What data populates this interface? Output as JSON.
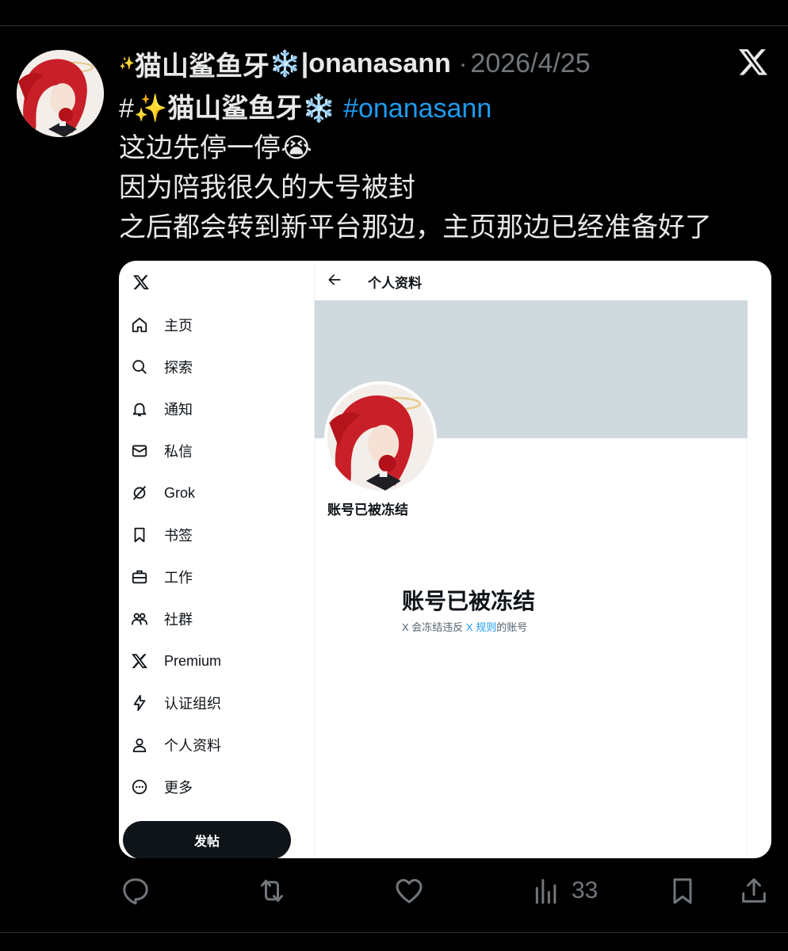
{
  "colors": {
    "background": "#000000",
    "text": "#e7e9ea",
    "muted": "#71767b",
    "link": "#1d9bf0",
    "banner": "#cfd9de",
    "post_button": "#0f1419"
  },
  "post": {
    "header": {
      "sparkle": "✨",
      "name": "猫山鲨鱼牙",
      "snowflake": "❄️",
      "handle": "|onanasann",
      "separator": "·",
      "date": "2026/4/25"
    },
    "line1": {
      "hash": "#",
      "sparkle": "✨",
      "name": "猫山鲨鱼牙",
      "snowflake": "❄️",
      "hashtag": "#onanasann"
    },
    "line2": "这边先停一停😭",
    "line3": "因为陪我很久的大号被封",
    "line4": "之后都会转到新平台那边，主页那边已经准备好了",
    "icons": [
      "x-logo-icon",
      "avatar",
      "sparkle-emoji",
      "snowflake-emoji",
      "crying-emoji"
    ]
  },
  "embedded": {
    "nav": [
      {
        "label": "主页",
        "icon": "home-icon"
      },
      {
        "label": "探索",
        "icon": "search-icon"
      },
      {
        "label": "通知",
        "icon": "bell-icon"
      },
      {
        "label": "私信",
        "icon": "mail-icon"
      },
      {
        "label": "Grok",
        "icon": "grok-icon"
      },
      {
        "label": "书签",
        "icon": "bookmark-icon"
      },
      {
        "label": "工作",
        "icon": "briefcase-icon"
      },
      {
        "label": "社群",
        "icon": "communities-icon"
      },
      {
        "label": "Premium",
        "icon": "x-icon"
      },
      {
        "label": "认证组织",
        "icon": "lightning-icon"
      },
      {
        "label": "个人资料",
        "icon": "profile-icon"
      },
      {
        "label": "更多",
        "icon": "more-icon"
      }
    ],
    "post_button": "发帖",
    "topbar_title": "个人资料",
    "frozen_label": "账号已被冻结",
    "frozen_title": "账号已被冻结",
    "frozen_desc_prefix": "X 会冻结违反",
    "frozen_desc_link": "X 规则",
    "frozen_desc_suffix": "的账号"
  },
  "actions": {
    "views_count": "33",
    "icons": [
      "reply-icon",
      "repost-icon",
      "like-icon",
      "views-icon",
      "bookmark-icon",
      "share-icon"
    ]
  }
}
